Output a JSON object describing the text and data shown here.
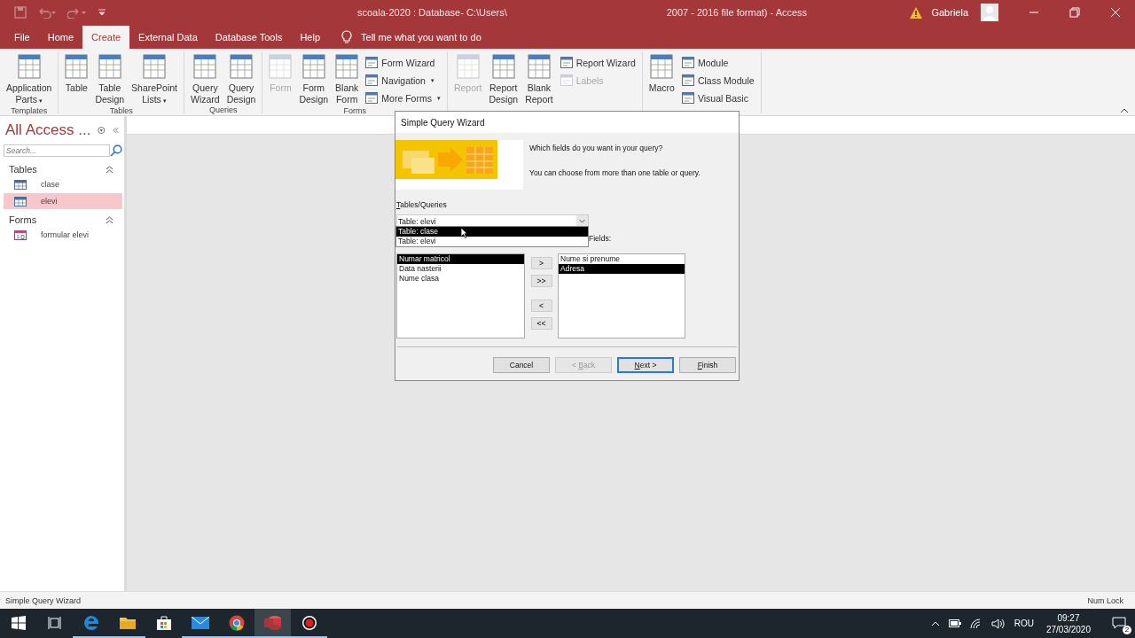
{
  "window": {
    "title_start": "scoala-2020 : Database- C:\\Users\\",
    "title_end": "2007 - 2016 file format)  -  Access",
    "user": "Gabriela"
  },
  "tabs": [
    {
      "label": "File",
      "selected": false
    },
    {
      "label": "Home",
      "selected": false
    },
    {
      "label": "Create",
      "selected": true
    },
    {
      "label": "External Data",
      "selected": false
    },
    {
      "label": "Database Tools",
      "selected": false
    },
    {
      "label": "Help",
      "selected": false
    }
  ],
  "tell_me": "Tell me what you want to do",
  "ribbon": [
    {
      "label": "Templates",
      "buttons": [
        {
          "kind": "large",
          "lines": [
            "Application",
            "Parts"
          ],
          "caret": "▾",
          "disabled": false
        }
      ]
    },
    {
      "label": "Tables",
      "buttons": [
        {
          "kind": "large",
          "lines": [
            "Table"
          ],
          "disabled": false
        },
        {
          "kind": "large",
          "lines": [
            "Table",
            "Design"
          ],
          "disabled": false
        },
        {
          "kind": "large",
          "lines": [
            "SharePoint",
            "Lists"
          ],
          "caret": "▾",
          "disabled": false
        }
      ]
    },
    {
      "label": "Queries",
      "buttons": [
        {
          "kind": "large",
          "lines": [
            "Query",
            "Wizard"
          ],
          "disabled": false
        },
        {
          "kind": "large",
          "lines": [
            "Query",
            "Design"
          ],
          "disabled": false
        }
      ]
    },
    {
      "label": "Forms",
      "buttons": [
        {
          "kind": "large",
          "lines": [
            "Form"
          ],
          "disabled": true
        },
        {
          "kind": "large",
          "lines": [
            "Form",
            "Design"
          ],
          "disabled": false
        },
        {
          "kind": "large",
          "lines": [
            "Blank",
            "Form"
          ],
          "disabled": false
        },
        {
          "kind": "small",
          "items": [
            {
              "label": "Form Wizard",
              "disabled": false
            },
            {
              "label": "Navigation",
              "caret": "▾",
              "disabled": false
            },
            {
              "label": "More Forms",
              "caret": "▾",
              "disabled": false
            }
          ]
        }
      ]
    },
    {
      "buttons": [
        {
          "kind": "large",
          "lines": [
            "Report"
          ],
          "disabled": true
        },
        {
          "kind": "large",
          "lines": [
            "Report",
            "Design"
          ],
          "disabled": false
        },
        {
          "kind": "large",
          "lines": [
            "Blank",
            "Report"
          ],
          "disabled": false
        },
        {
          "kind": "small",
          "items": [
            {
              "label": "Report Wizard",
              "disabled": false
            },
            {
              "label": "Labels",
              "disabled": true
            }
          ]
        }
      ]
    },
    {
      "buttons": [
        {
          "kind": "large",
          "lines": [
            "Macro"
          ],
          "disabled": false
        },
        {
          "kind": "small",
          "items": [
            {
              "label": "Module",
              "disabled": false
            },
            {
              "label": "Class Module",
              "disabled": false
            },
            {
              "label": "Visual Basic",
              "disabled": false
            }
          ]
        }
      ]
    }
  ],
  "nav": {
    "title": "All Access ...",
    "search_placeholder": "Search...",
    "groups": [
      {
        "label": "Tables",
        "items": [
          {
            "label": "clase",
            "kind": "table",
            "selected": false
          },
          {
            "label": "elevi",
            "kind": "table",
            "selected": true
          }
        ]
      },
      {
        "label": "Forms",
        "items": [
          {
            "label": "formular elevi",
            "kind": "form",
            "selected": false
          }
        ]
      }
    ]
  },
  "dialog": {
    "title": "Simple Query Wizard",
    "prompt": "Which fields do you want in your query?",
    "hint": "You can choose from more than one table or query.",
    "tables_label": {
      "key": "T",
      "after": "ables/Queries"
    },
    "combo_value": "Table: elevi",
    "combo_options": [
      {
        "label": "Table: clase",
        "selected": true
      },
      {
        "label": "Table: elevi",
        "selected": false
      }
    ],
    "selected_fields_label": "Fields:",
    "available": [
      {
        "label": "Numar matricol",
        "selected": true
      },
      {
        "label": "Data nasterii",
        "selected": false
      },
      {
        "label": "Nume clasa",
        "selected": false
      }
    ],
    "move_buttons": [
      ">",
      ">>",
      "<",
      "<<"
    ],
    "chosen": [
      {
        "label": "Nume si prenume",
        "selected": false
      },
      {
        "label": "Adresa",
        "selected": true
      }
    ],
    "buttons": [
      {
        "label": {
          "before": "Cancel"
        },
        "disabled": false,
        "default": false
      },
      {
        "label": {
          "before": "< ",
          "key": "B",
          "after": "ack"
        },
        "disabled": true,
        "default": false
      },
      {
        "label": {
          "key": "N",
          "after": "ext >"
        },
        "disabled": false,
        "default": true
      },
      {
        "label": {
          "key": "F",
          "after": "inish"
        },
        "disabled": false,
        "default": false
      }
    ]
  },
  "status_bar": {
    "left": "Simple Query Wizard",
    "right": "Num Lock"
  },
  "taskbar": {
    "apps": [
      {
        "kind": "start",
        "running": false,
        "selected": false
      },
      {
        "kind": "taskview",
        "running": false,
        "selected": false
      },
      {
        "kind": "edge",
        "running": true,
        "selected": false
      },
      {
        "kind": "explorer",
        "running": true,
        "selected": false
      },
      {
        "kind": "store",
        "running": false,
        "selected": false
      },
      {
        "kind": "mail",
        "running": true,
        "selected": false
      },
      {
        "kind": "chrome",
        "running": true,
        "selected": false
      },
      {
        "kind": "access",
        "running": true,
        "selected": true
      },
      {
        "kind": "record",
        "running": true,
        "selected": false
      }
    ],
    "language": "ROU",
    "time": "09:27",
    "date": "27/03/2020",
    "notifications": "2"
  }
}
